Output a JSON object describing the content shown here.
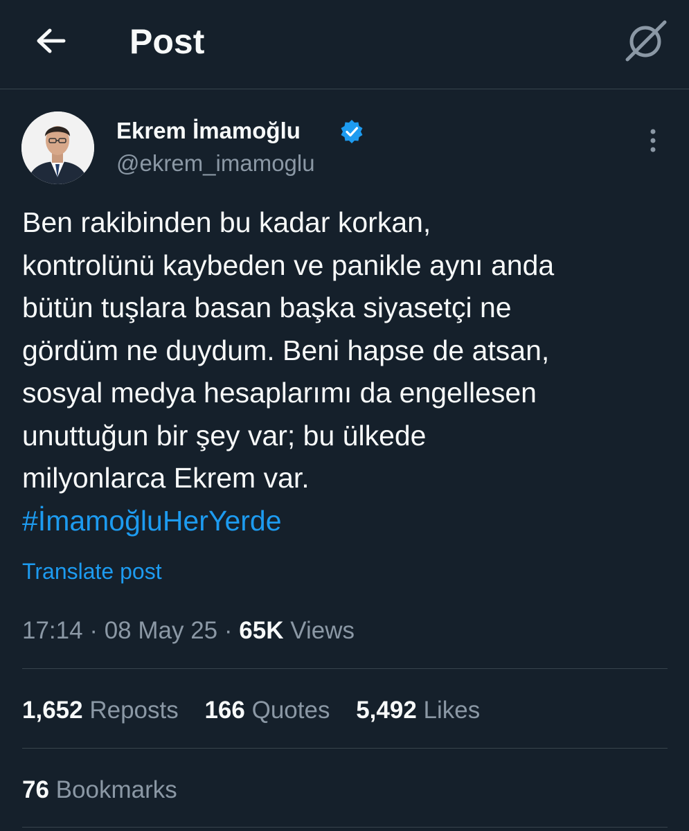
{
  "header": {
    "title": "Post",
    "back_icon": "arrow-left-icon",
    "grok_icon": "grok-icon"
  },
  "author": {
    "display_name": "Ekrem İmamoğlu",
    "handle": "@ekrem_imamoglu",
    "verified": true,
    "verified_color": "#1d9bf0"
  },
  "post": {
    "lines": [
      "Ben rakibinden bu kadar korkan,",
      "kontrolünü kaybeden ve panikle aynı anda",
      "bütün tuşlara basan başka siyasetçi ne",
      "gördüm ne duydum. Beni hapse de atsan,",
      "sosyal medya hesaplarımı da engellesen",
      "unuttuğun bir şey var; bu ülkede",
      "milyonlarca Ekrem var."
    ],
    "hashtag": "#İmamoğluHerYerde",
    "translate_label": "Translate post"
  },
  "meta": {
    "time": "17:14",
    "separator": "·",
    "date": "08 May 25",
    "views_count": "65K",
    "views_label": "Views"
  },
  "stats": {
    "reposts_count": "1,652",
    "reposts_label": "Reposts",
    "quotes_count": "166",
    "quotes_label": "Quotes",
    "likes_count": "5,492",
    "likes_label": "Likes",
    "bookmarks_count": "76",
    "bookmarks_label": "Bookmarks"
  },
  "colors": {
    "background": "#15202b",
    "text": "#f7f9f9",
    "secondary_text": "#8b98a5",
    "accent": "#1d9bf0",
    "divider": "#38444d"
  }
}
